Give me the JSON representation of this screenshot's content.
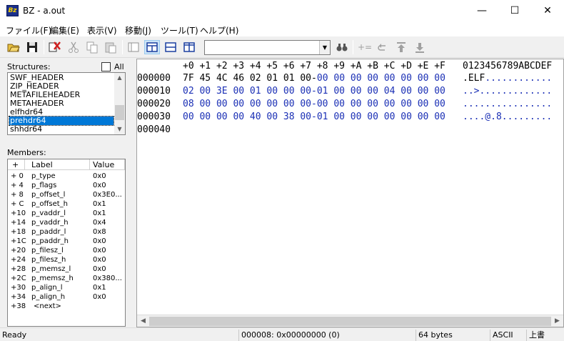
{
  "window": {
    "title": "BZ - a.out",
    "app_icon_text": "Bz"
  },
  "window_controls": {
    "minimize": "—",
    "maximize": "☐",
    "close": "✕"
  },
  "menu": [
    "ファイル(F)",
    "編集(E)",
    "表示(V)",
    "移動(J)",
    "ツール(T)",
    "ヘルプ(H)"
  ],
  "toolbar": {
    "icons": [
      "open-icon",
      "save-icon",
      "delete-icon",
      "cut-icon",
      "copy-icon",
      "paste-icon",
      "view-single-icon",
      "view-split-vertical-icon",
      "view-split-horizontal-icon",
      "view-compare-icon",
      "find-icon",
      "assign-icon",
      "undo-icon",
      "jump-up-icon",
      "jump-down-icon"
    ],
    "combo_value": ""
  },
  "structures": {
    "label": "Structures:",
    "all_label": "All",
    "items": [
      "SWF_HEADER",
      "ZIP_HEADER",
      "METAFILEHEADER",
      "METAHEADER",
      "elfhdr64",
      "prehdr64",
      "shhdr64"
    ],
    "selected_index": 5
  },
  "members": {
    "label": "Members:",
    "headers": [
      "+",
      "Label",
      "Value"
    ],
    "rows": [
      [
        "+ 0",
        "p_type",
        "0x0"
      ],
      [
        "+ 4",
        "p_flags",
        "0x0"
      ],
      [
        "+ 8",
        "p_offset_l",
        "0x3E0..."
      ],
      [
        "+ C",
        "p_offset_h",
        "0x1"
      ],
      [
        "+10",
        "p_vaddr_l",
        "0x1"
      ],
      [
        "+14",
        "p_vaddr_h",
        "0x4"
      ],
      [
        "+18",
        "p_paddr_l",
        "0x8"
      ],
      [
        "+1C",
        "p_paddr_h",
        "0x0"
      ],
      [
        "+20",
        "p_filesz_l",
        "0x0"
      ],
      [
        "+24",
        "p_filesz_h",
        "0x0"
      ],
      [
        "+28",
        "p_memsz_l",
        "0x0"
      ],
      [
        "+2C",
        "p_memsz_h",
        "0x380..."
      ],
      [
        "+30",
        "p_align_l",
        "0x1"
      ],
      [
        "+34",
        "p_align_h",
        "0x0"
      ],
      [
        "+38",
        "<next>",
        ""
      ]
    ]
  },
  "hex": {
    "header_cols": "+0 +1 +2 +3 +4 +5 +6 +7 +8 +9 +A +B +C +D +E +F",
    "header_ascii": "0123456789ABCDEF",
    "rows": [
      {
        "addr": "000000",
        "black": "7F 45 4C 46 02 01 01 00-",
        "blue": "00 00 00 00 00 00 00 00",
        "ascii_black": ".ELF",
        "ascii_blue": "............"
      },
      {
        "addr": "000010",
        "black": "",
        "blue": "02 00 3E 00 01 00 00 00-01 00 00 00 04 00 00 00",
        "ascii_black": "",
        "ascii_blue": "..>............."
      },
      {
        "addr": "000020",
        "black": "",
        "blue": "08 00 00 00 00 00 00 00-00 00 00 00 00 00 00 00",
        "ascii_black": "",
        "ascii_blue": "................"
      },
      {
        "addr": "000030",
        "black": "",
        "blue": "00 00 00 00 40 00 38 00-01 00 00 00 00 00 00 00",
        "ascii_black": "",
        "ascii_blue": "....@.8........."
      },
      {
        "addr": "000040",
        "black": "",
        "blue": "",
        "ascii_black": "",
        "ascii_blue": ""
      }
    ]
  },
  "status": {
    "message": "Ready",
    "position": "000008: 0x00000000 (0)",
    "size": "64 bytes",
    "encoding": "ASCII",
    "mode": "上書"
  }
}
